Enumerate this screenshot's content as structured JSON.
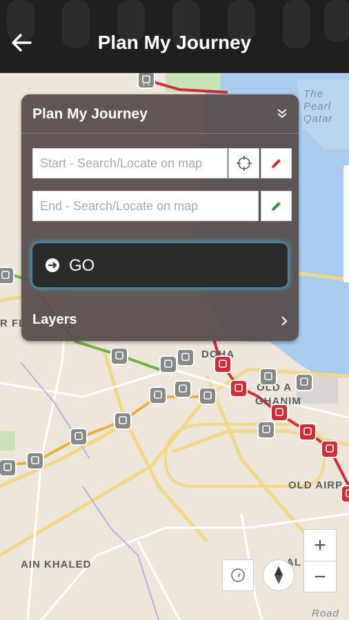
{
  "header": {
    "title": "Plan My Journey"
  },
  "panel": {
    "title": "Plan My Journey",
    "start_placeholder": "Start - Search/Locate on map",
    "end_placeholder": "End - Search/Locate on map",
    "go_label": "GO",
    "layers_label": "Layers"
  },
  "map": {
    "labels": [
      "The",
      "Pearl",
      "Qatar",
      "DOHA",
      "OLD A",
      "GHANIM",
      "OLD AIRP",
      "AIN KHALED",
      "AL",
      "Road",
      "R FL"
    ],
    "controls": {
      "zoom_in": "+",
      "zoom_out": "−"
    }
  },
  "colors": {
    "accent_glow": "#3fa9d6",
    "red_line": "#d22b35",
    "green_line": "#6bb33c",
    "gold_line": "#e8b13a",
    "panel_bg": "#584e4c"
  }
}
